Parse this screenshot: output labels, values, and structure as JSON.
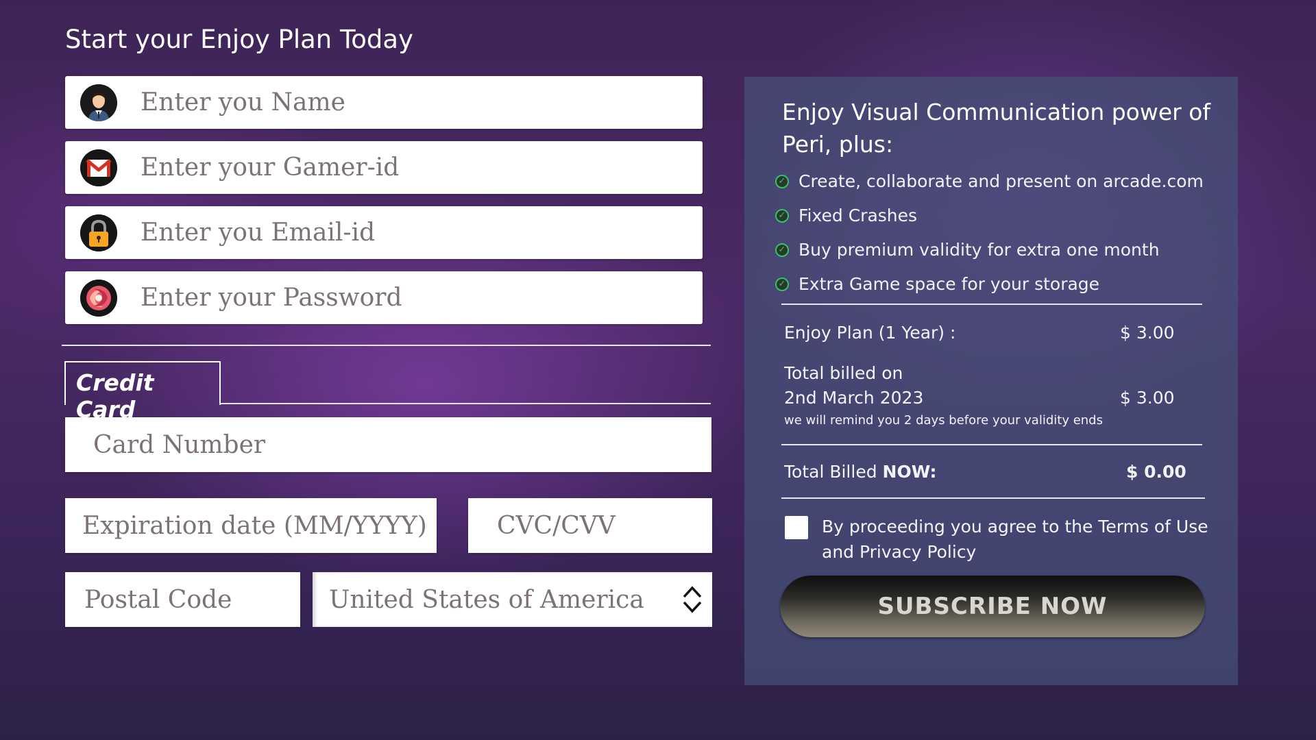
{
  "page": {
    "title": "Start your Enjoy Plan Today"
  },
  "form": {
    "name_placeholder": "Enter you Name",
    "gamer_id_placeholder": "Enter your Gamer-id",
    "email_placeholder": "Enter you Email-id",
    "password_placeholder": "Enter your Password",
    "tab_label": "Credit Card",
    "card_number_placeholder": "Card Number",
    "expiration_placeholder": "Expiration date (MM/YYYY)",
    "cvc_placeholder": "CVC/CVV",
    "postal_placeholder": "Postal Code",
    "country_value": "United States of America"
  },
  "icons": {
    "name": "user-avatar-icon",
    "gamer_id": "gmail-icon",
    "email": "lock-icon",
    "password": "swirl-logo-icon",
    "checkmark": "check-circle-icon",
    "select": "up-down-arrows-icon"
  },
  "summary": {
    "title": "Enjoy Visual Communication power of Peri, plus:",
    "features": [
      "Create, collaborate and present on arcade.com",
      "Fixed Crashes",
      "Buy premium validity for extra one month",
      "Extra Game space for your storage"
    ],
    "plan_label": "Enjoy Plan (1 Year) :",
    "plan_price": "$ 3.00",
    "billed_on_line1": "Total billed on",
    "billed_on_line2": "2nd March 2023",
    "billed_on_price": "$ 3.00",
    "reminder": "we will remind you 2 days before your validity ends",
    "total_label_prefix": "Total Billed ",
    "total_label_bold": "NOW:",
    "total_price": "$ 0.00",
    "terms_text": "By proceeding you agree to the Terms of Use and Privacy Policy",
    "subscribe_button": "SUBSCRIBE NOW"
  },
  "colors": {
    "check_green": "#35c06a",
    "panel_bg": "#46527a",
    "placeholder": "#7d7373"
  }
}
